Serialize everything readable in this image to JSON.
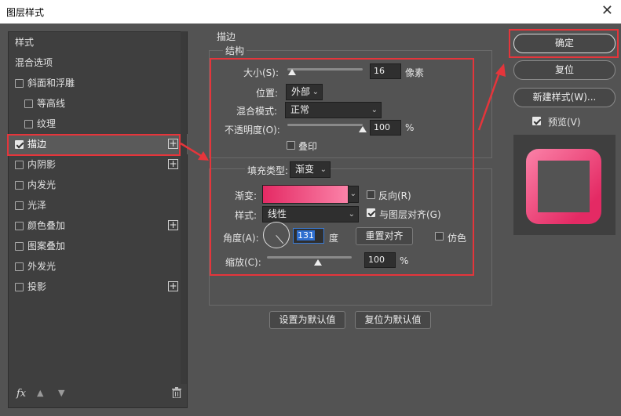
{
  "window": {
    "title": "图层样式",
    "close": "✕"
  },
  "left": {
    "items": [
      {
        "label": "样式",
        "checkbox": false,
        "checked": false,
        "plus": false,
        "indent": false,
        "selected": false
      },
      {
        "label": "混合选项",
        "checkbox": false,
        "checked": false,
        "plus": false,
        "indent": false,
        "selected": false
      },
      {
        "label": "斜面和浮雕",
        "checkbox": true,
        "checked": false,
        "plus": false,
        "indent": false,
        "selected": false
      },
      {
        "label": "等高线",
        "checkbox": true,
        "checked": false,
        "plus": false,
        "indent": true,
        "selected": false
      },
      {
        "label": "纹理",
        "checkbox": true,
        "checked": false,
        "plus": false,
        "indent": true,
        "selected": false
      },
      {
        "label": "描边",
        "checkbox": true,
        "checked": true,
        "plus": true,
        "indent": false,
        "selected": true
      },
      {
        "label": "内阴影",
        "checkbox": true,
        "checked": false,
        "plus": true,
        "indent": false,
        "selected": false
      },
      {
        "label": "内发光",
        "checkbox": true,
        "checked": false,
        "plus": false,
        "indent": false,
        "selected": false
      },
      {
        "label": "光泽",
        "checkbox": true,
        "checked": false,
        "plus": false,
        "indent": false,
        "selected": false
      },
      {
        "label": "颜色叠加",
        "checkbox": true,
        "checked": false,
        "plus": true,
        "indent": false,
        "selected": false
      },
      {
        "label": "图案叠加",
        "checkbox": true,
        "checked": false,
        "plus": false,
        "indent": false,
        "selected": false
      },
      {
        "label": "外发光",
        "checkbox": true,
        "checked": false,
        "plus": false,
        "indent": false,
        "selected": false
      },
      {
        "label": "投影",
        "checkbox": true,
        "checked": false,
        "plus": true,
        "indent": false,
        "selected": false
      }
    ],
    "toolbar": {
      "fx": "fx",
      "up": "▲",
      "down": "▼"
    }
  },
  "stroke": {
    "section_title": "描边",
    "structure_title": "结构",
    "size_label": "大小(S):",
    "size_value": "16",
    "size_unit": "像素",
    "size_level": 0.06,
    "position_label": "位置:",
    "position_value": "外部",
    "blend_label": "混合模式:",
    "blend_value": "正常",
    "opacity_label": "不透明度(O):",
    "opacity_value": "100",
    "opacity_unit": "%",
    "opacity_level": 1.0,
    "overprint_label": "叠印",
    "fill_type_label": "填充类型:",
    "fill_type_value": "渐变",
    "gradient_label": "渐变:",
    "reverse_label": "反向(R)",
    "style_label": "样式:",
    "style_value": "线性",
    "align_label": "与图层对齐(G)",
    "angle_label": "角度(A):",
    "angle_value": "131",
    "angle_unit": "度",
    "reset_align_button": "重置对齐",
    "dither_label": "仿色",
    "scale_label": "缩放(C):",
    "scale_value": "100",
    "scale_unit": "%",
    "scale_level": 0.5
  },
  "bottom": {
    "set_default": "设置为默认值",
    "reset_default": "复位为默认值"
  },
  "right": {
    "ok": "确定",
    "reset": "复位",
    "new_style": "新建样式(W)...",
    "preview_label": "预览(V)"
  },
  "colors": {
    "highlight": "#e5353b",
    "gradient_start": "#e42a64",
    "gradient_end": "#fb82a8"
  }
}
